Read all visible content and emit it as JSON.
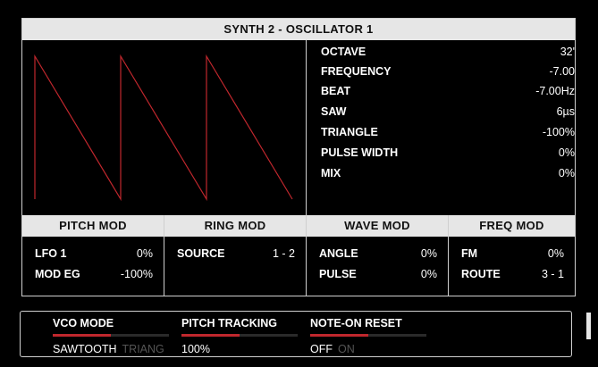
{
  "title": "SYNTH 2 - OSCILLATOR 1",
  "colors": {
    "accent": "#c0272d",
    "header_bg": "#e6e6e6",
    "background": "#000000",
    "waveform": "#c0272d"
  },
  "waveform": {
    "shape": "sawtooth",
    "cycles": 3
  },
  "params": [
    {
      "label": "OCTAVE",
      "value": "32'"
    },
    {
      "label": "FREQUENCY",
      "value": "-7.00"
    },
    {
      "label": "BEAT",
      "value": "-7.00Hz"
    },
    {
      "label": "SAW",
      "value": "6µs"
    },
    {
      "label": "TRIANGLE",
      "value": "-100%"
    },
    {
      "label": "PULSE WIDTH",
      "value": "0%"
    },
    {
      "label": "MIX",
      "value": "0%"
    }
  ],
  "mods": [
    {
      "header": "PITCH MOD",
      "rows": [
        {
          "label": "LFO 1",
          "value": "0%"
        },
        {
          "label": "MOD EG",
          "value": "-100%"
        }
      ]
    },
    {
      "header": "RING MOD",
      "rows": [
        {
          "label": "SOURCE",
          "value": "1 - 2"
        }
      ]
    },
    {
      "header": "WAVE MOD",
      "rows": [
        {
          "label": "ANGLE",
          "value": "0%"
        },
        {
          "label": "PULSE",
          "value": "0%"
        }
      ]
    },
    {
      "header": "FREQ MOD",
      "rows": [
        {
          "label": "FM",
          "value": "0%"
        },
        {
          "label": "ROUTE",
          "value": "3 - 1"
        }
      ]
    }
  ],
  "bottom": {
    "vco_mode": {
      "label": "VCO MODE",
      "value": "SAWTOOTH",
      "other_option": "TRIANG",
      "level": 0.5
    },
    "pitch_tracking": {
      "label": "PITCH TRACKING",
      "value": "100%",
      "level": 0.5
    },
    "note_on_reset": {
      "label": "NOTE-ON RESET",
      "value": "OFF",
      "other_option": "ON",
      "level": 0.5
    }
  }
}
